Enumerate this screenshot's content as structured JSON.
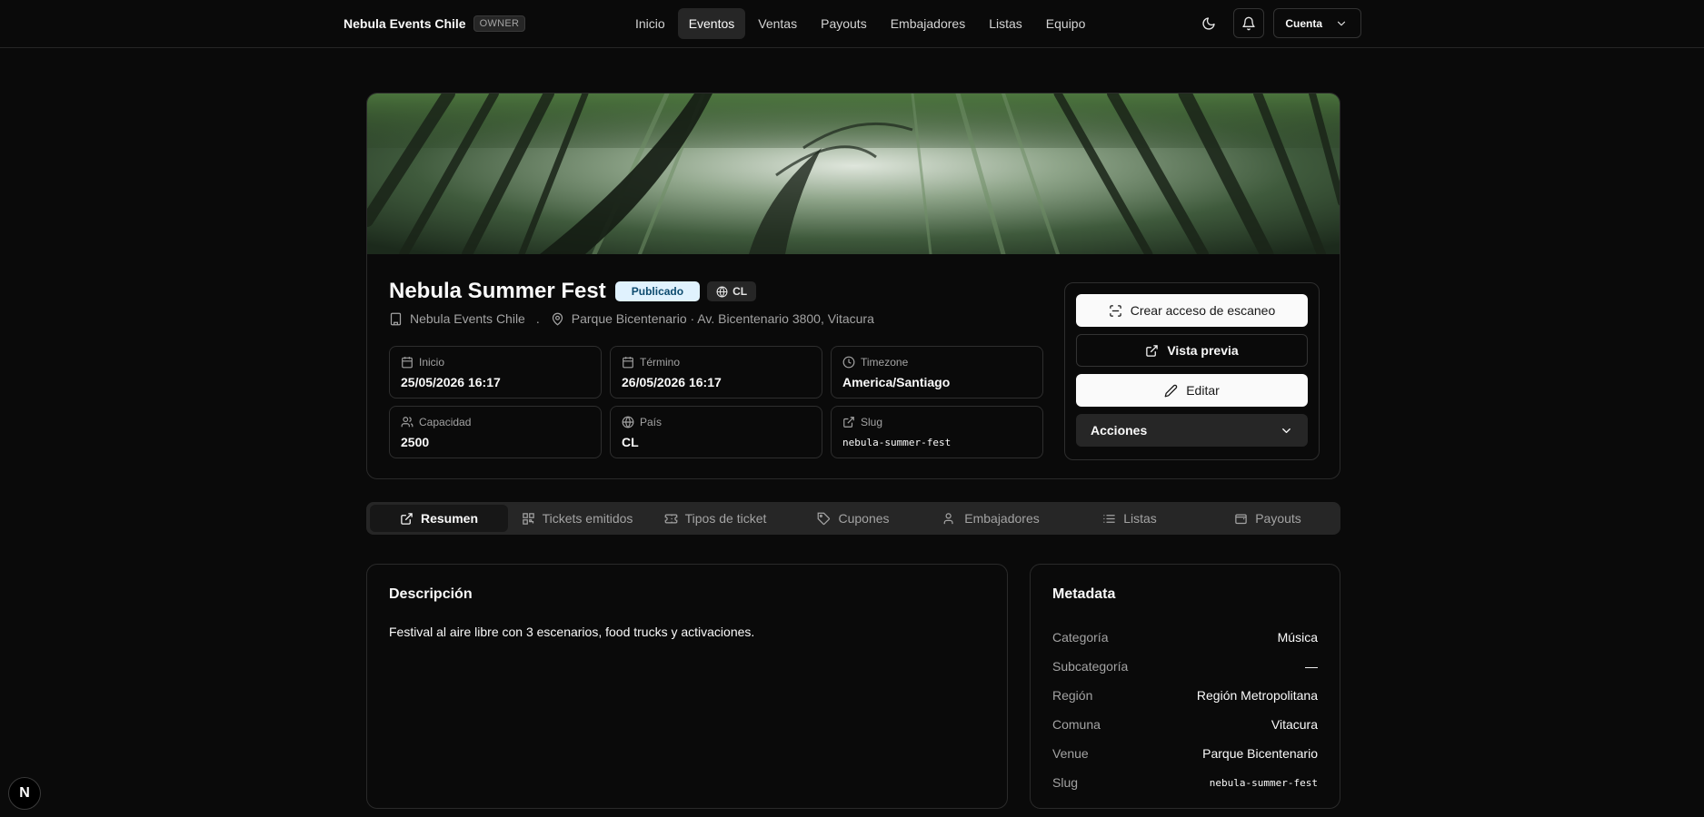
{
  "header": {
    "brand": "Nebula Events Chile",
    "role": "OWNER",
    "nav": [
      "Inicio",
      "Eventos",
      "Ventas",
      "Payouts",
      "Embajadores",
      "Listas",
      "Equipo"
    ],
    "active_nav": "Eventos",
    "account_label": "Cuenta"
  },
  "event": {
    "title": "Nebula Summer Fest",
    "status": "Publicado",
    "country_chip": "CL",
    "organizer": "Nebula Events Chile",
    "separator": ".",
    "location": "Parque Bicentenario · Av. Bicentenario 3800, Vitacura",
    "info": [
      {
        "label": "Inicio",
        "value": "25/05/2026 16:17",
        "icon": "calendar-icon"
      },
      {
        "label": "Término",
        "value": "26/05/2026 16:17",
        "icon": "calendar-icon"
      },
      {
        "label": "Timezone",
        "value": "America/Santiago",
        "icon": "clock-icon"
      },
      {
        "label": "Capacidad",
        "value": "2500",
        "icon": "users-icon"
      },
      {
        "label": "País",
        "value": "CL",
        "icon": "globe-icon"
      },
      {
        "label": "Slug",
        "value": "nebula-summer-fest",
        "icon": "external-link-icon"
      }
    ]
  },
  "actions": {
    "scan_access": "Crear acceso de escaneo",
    "preview": "Vista previa",
    "edit": "Editar",
    "more": "Acciones"
  },
  "tabs": [
    {
      "label": "Resumen",
      "icon": "external-link-icon"
    },
    {
      "label": "Tickets emitidos",
      "icon": "qr-code-icon"
    },
    {
      "label": "Tipos de ticket",
      "icon": "ticket-icon"
    },
    {
      "label": "Cupones",
      "icon": "tag-icon"
    },
    {
      "label": "Embajadores",
      "icon": "user-icon"
    },
    {
      "label": "Listas",
      "icon": "list-icon"
    },
    {
      "label": "Payouts",
      "icon": "wallet-icon"
    }
  ],
  "active_tab": "Resumen",
  "description": {
    "title": "Descripción",
    "text": "Festival al aire libre con 3 escenarios, food trucks y activaciones."
  },
  "metadata": {
    "title": "Metadata",
    "rows": [
      {
        "key": "Categoría",
        "value": "Música"
      },
      {
        "key": "Subcategoría",
        "value": "—"
      },
      {
        "key": "Región",
        "value": "Región Metropolitana"
      },
      {
        "key": "Comuna",
        "value": "Vitacura"
      },
      {
        "key": "Venue",
        "value": "Parque Bicentenario"
      },
      {
        "key": "Slug",
        "value": "nebula-summer-fest"
      }
    ]
  },
  "colors": {
    "background": "#0a0a0a",
    "status_badge_bg": "#e0f2fe",
    "status_badge_text": "#0c4a6e",
    "active_tab_bg": "#171717"
  },
  "framework_badge": "N"
}
